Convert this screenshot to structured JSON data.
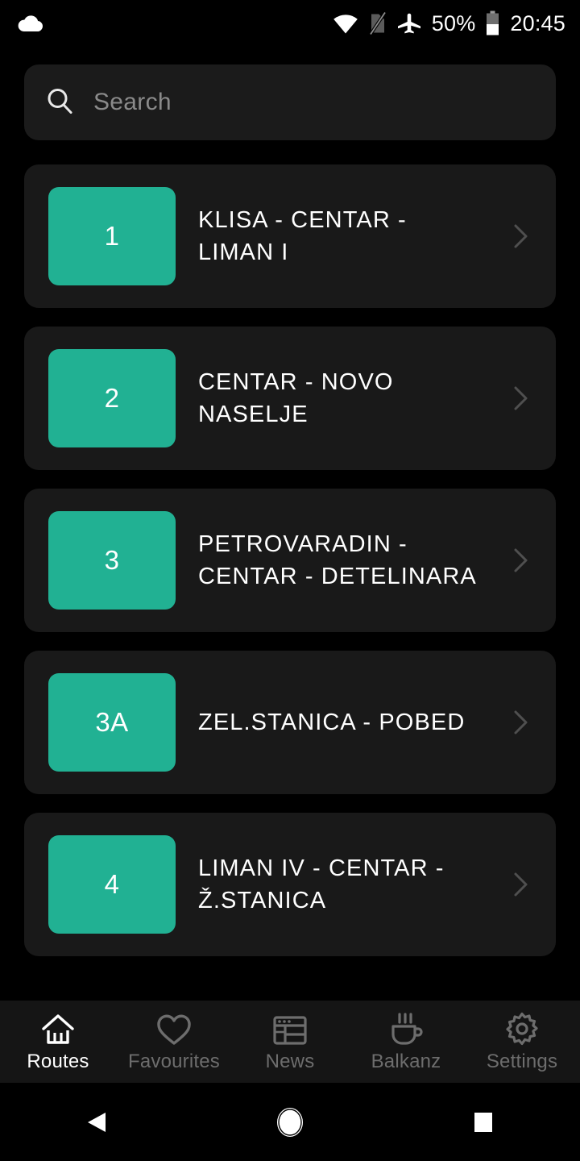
{
  "status_bar": {
    "notification_icon": "cloud-icon",
    "wifi_icon": "wifi-icon",
    "sim_icon": "no-sim-icon",
    "airplane_icon": "airplane-mode-icon",
    "battery_percent": "50%",
    "battery_icon": "battery-half-icon",
    "clock": "20:45"
  },
  "search": {
    "icon": "search-icon",
    "placeholder": "Search",
    "value": ""
  },
  "routes": [
    {
      "number": "1",
      "name": "KLISA - CENTAR - LIMAN I"
    },
    {
      "number": "2",
      "name": "CENTAR - NOVO NASELJE"
    },
    {
      "number": "3",
      "name": "PETROVARADIN - CENTAR - DETELINARA"
    },
    {
      "number": "3A",
      "name": "ZEL.STANICA - POBED"
    },
    {
      "number": "4",
      "name": "LIMAN IV - CENTAR - Ž.STANICA"
    }
  ],
  "bottom_nav": {
    "items": [
      {
        "label": "Routes",
        "icon": "home-icon",
        "active": true
      },
      {
        "label": "Favourites",
        "icon": "heart-icon",
        "active": false
      },
      {
        "label": "News",
        "icon": "newspaper-icon",
        "active": false
      },
      {
        "label": "Balkanz",
        "icon": "coffee-cup-icon",
        "active": false
      },
      {
        "label": "Settings",
        "icon": "gear-icon",
        "active": false
      }
    ]
  },
  "system_nav": {
    "back": "back-triangle-icon",
    "home": "home-circle-icon",
    "recents": "recents-square-icon"
  },
  "colors": {
    "accent": "#21b193",
    "page_background": "#000000",
    "card_background": "#191919",
    "search_background": "#1b1b1b",
    "nav_background": "#151515",
    "text_primary": "#ffffff",
    "text_muted": "#6d6d6d",
    "placeholder": "#8a8a8a"
  }
}
